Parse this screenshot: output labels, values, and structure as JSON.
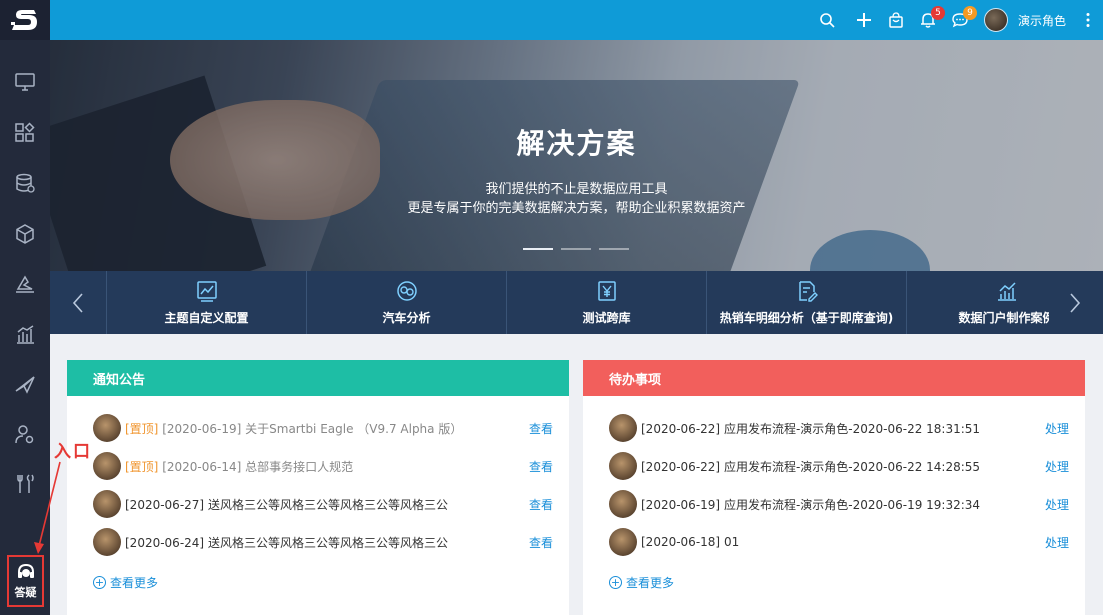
{
  "header": {
    "user_name": "演示角色",
    "notif_badge": "5",
    "msg_badge": "9",
    "colors": {
      "bar": "#0f9bd7",
      "notif_badge": "#e53935",
      "msg_badge": "#f59a23"
    }
  },
  "sidebar": {
    "items": [
      "monitor-icon",
      "apps-icon",
      "database-icon",
      "cube-icon",
      "layers-icon",
      "bar-chart-icon",
      "send-icon",
      "user-settings-icon",
      "tools-icon"
    ],
    "help_label": "答疑"
  },
  "banner": {
    "title": "解决方案",
    "line1": "我们提供的不止是数据应用工具",
    "line2": "更是专属于你的完美数据解决方案，帮助企业积累数据资产"
  },
  "apps": [
    {
      "label": "主题自定义配置",
      "icon": "chart-edit-icon"
    },
    {
      "label": "汽车分析",
      "icon": "swap-icon"
    },
    {
      "label": "测试跨库",
      "icon": "yen-icon"
    },
    {
      "label": "热销车明细分析（基于即席查询)",
      "icon": "doc-edit-icon"
    },
    {
      "label": "数据门户制作案例",
      "icon": "line-chart-icon"
    }
  ],
  "notices": {
    "title": "通知公告",
    "color": "#1ebea5",
    "more": "查看更多",
    "items": [
      {
        "tag": "[置顶]",
        "date": "[2020-06-19]",
        "text": "关于Smartbi Eagle （V9.7 Alpha 版）",
        "action": "查看"
      },
      {
        "tag": "[置顶]",
        "date": "[2020-06-14]",
        "text": "总部事务接口人规范",
        "action": "查看"
      },
      {
        "tag": "",
        "date": "[2020-06-27]",
        "text": "送风格三公等风格三公等风格三公等风格三公",
        "action": "查看"
      },
      {
        "tag": "",
        "date": "[2020-06-24]",
        "text": "送风格三公等风格三公等风格三公等风格三公",
        "action": "查看"
      }
    ]
  },
  "todos": {
    "title": "待办事项",
    "color": "#f25f5c",
    "more": "查看更多",
    "items": [
      {
        "date": "[2020-06-22]",
        "text": "应用发布流程-演示角色-2020-06-22 18:31:51",
        "action": "处理"
      },
      {
        "date": "[2020-06-22]",
        "text": "应用发布流程-演示角色-2020-06-22 14:28:55",
        "action": "处理"
      },
      {
        "date": "[2020-06-19]",
        "text": "应用发布流程-演示角色-2020-06-19 19:32:34",
        "action": "处理"
      },
      {
        "date": "[2020-06-18]",
        "text": "01",
        "action": "处理"
      }
    ]
  },
  "annotation": {
    "text": "入口",
    "color": "#e53935"
  }
}
